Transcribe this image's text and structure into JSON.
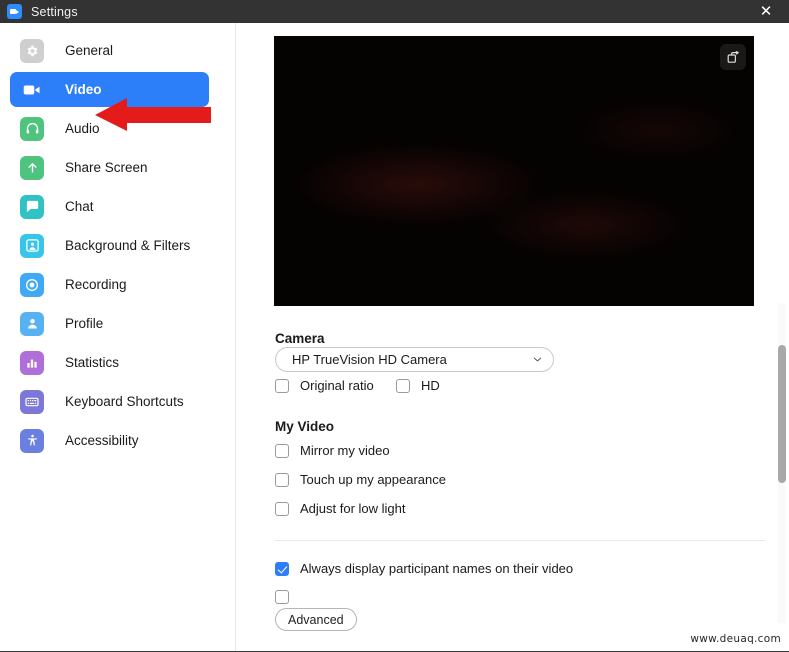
{
  "window": {
    "title": "Settings",
    "app_icon": "zoom-camera-icon",
    "close_label": "✕"
  },
  "sidebar": {
    "items": [
      {
        "label": "General",
        "icon": "gear-icon",
        "color": "#cfcfcf",
        "selected": false
      },
      {
        "label": "Video",
        "icon": "video-camera-icon",
        "color": "#2d7ff9",
        "selected": true
      },
      {
        "label": "Audio",
        "icon": "headphones-icon",
        "color": "#4fc47f",
        "selected": false
      },
      {
        "label": "Share Screen",
        "icon": "upload-arrow-icon",
        "color": "#4fc47f",
        "selected": false
      },
      {
        "label": "Chat",
        "icon": "chat-bubble-icon",
        "color": "#31c3c3",
        "selected": false
      },
      {
        "label": "Background & Filters",
        "icon": "person-frame-icon",
        "color": "#38c6e8",
        "selected": false
      },
      {
        "label": "Recording",
        "icon": "record-circle-icon",
        "color": "#3fa9f5",
        "selected": false
      },
      {
        "label": "Profile",
        "icon": "person-icon",
        "color": "#56b2f0",
        "selected": false
      },
      {
        "label": "Statistics",
        "icon": "bar-chart-icon",
        "color": "#b06fd8",
        "selected": false
      },
      {
        "label": "Keyboard Shortcuts",
        "icon": "keyboard-icon",
        "color": "#7b78d8",
        "selected": false
      },
      {
        "label": "Accessibility",
        "icon": "accessibility-icon",
        "color": "#6a7fe0",
        "selected": false
      }
    ]
  },
  "annotation": {
    "type": "left-pointing-arrow",
    "color": "#e51b1b",
    "target": "Video"
  },
  "content": {
    "preview": {
      "popout_icon": "pop-out-window-icon"
    },
    "camera": {
      "heading": "Camera",
      "selected_device": "HP TrueVision HD Camera",
      "chevron_icon": "chevron-down-icon",
      "options": [
        {
          "label": "Original ratio",
          "checked": false
        },
        {
          "label": "HD",
          "checked": false
        }
      ]
    },
    "my_video": {
      "heading": "My Video",
      "options": [
        {
          "label": "Mirror my video",
          "checked": false
        },
        {
          "label": "Touch up my appearance",
          "checked": false
        },
        {
          "label": "Adjust for low light",
          "checked": false
        }
      ]
    },
    "meetings": {
      "options": [
        {
          "label": "Always display participant names on their video",
          "checked": true
        }
      ]
    },
    "advanced_label": "Advanced"
  },
  "watermark": "www.deuaq.com",
  "colors": {
    "accent": "#2d7ff9",
    "titlebar": "#333333",
    "annotation_red": "#e51b1b"
  }
}
